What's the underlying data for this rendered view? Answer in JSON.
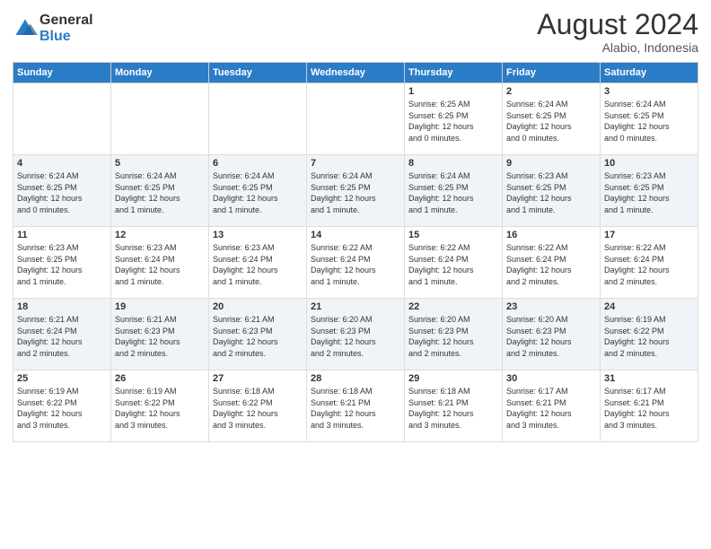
{
  "header": {
    "logo_general": "General",
    "logo_blue": "Blue",
    "main_title": "August 2024",
    "subtitle": "Alabio, Indonesia"
  },
  "days_of_week": [
    "Sunday",
    "Monday",
    "Tuesday",
    "Wednesday",
    "Thursday",
    "Friday",
    "Saturday"
  ],
  "weeks": [
    [
      {
        "num": "",
        "info": ""
      },
      {
        "num": "",
        "info": ""
      },
      {
        "num": "",
        "info": ""
      },
      {
        "num": "",
        "info": ""
      },
      {
        "num": "1",
        "info": "Sunrise: 6:25 AM\nSunset: 6:25 PM\nDaylight: 12 hours\nand 0 minutes."
      },
      {
        "num": "2",
        "info": "Sunrise: 6:24 AM\nSunset: 6:25 PM\nDaylight: 12 hours\nand 0 minutes."
      },
      {
        "num": "3",
        "info": "Sunrise: 6:24 AM\nSunset: 6:25 PM\nDaylight: 12 hours\nand 0 minutes."
      }
    ],
    [
      {
        "num": "4",
        "info": "Sunrise: 6:24 AM\nSunset: 6:25 PM\nDaylight: 12 hours\nand 0 minutes."
      },
      {
        "num": "5",
        "info": "Sunrise: 6:24 AM\nSunset: 6:25 PM\nDaylight: 12 hours\nand 1 minute."
      },
      {
        "num": "6",
        "info": "Sunrise: 6:24 AM\nSunset: 6:25 PM\nDaylight: 12 hours\nand 1 minute."
      },
      {
        "num": "7",
        "info": "Sunrise: 6:24 AM\nSunset: 6:25 PM\nDaylight: 12 hours\nand 1 minute."
      },
      {
        "num": "8",
        "info": "Sunrise: 6:24 AM\nSunset: 6:25 PM\nDaylight: 12 hours\nand 1 minute."
      },
      {
        "num": "9",
        "info": "Sunrise: 6:23 AM\nSunset: 6:25 PM\nDaylight: 12 hours\nand 1 minute."
      },
      {
        "num": "10",
        "info": "Sunrise: 6:23 AM\nSunset: 6:25 PM\nDaylight: 12 hours\nand 1 minute."
      }
    ],
    [
      {
        "num": "11",
        "info": "Sunrise: 6:23 AM\nSunset: 6:25 PM\nDaylight: 12 hours\nand 1 minute."
      },
      {
        "num": "12",
        "info": "Sunrise: 6:23 AM\nSunset: 6:24 PM\nDaylight: 12 hours\nand 1 minute."
      },
      {
        "num": "13",
        "info": "Sunrise: 6:23 AM\nSunset: 6:24 PM\nDaylight: 12 hours\nand 1 minute."
      },
      {
        "num": "14",
        "info": "Sunrise: 6:22 AM\nSunset: 6:24 PM\nDaylight: 12 hours\nand 1 minute."
      },
      {
        "num": "15",
        "info": "Sunrise: 6:22 AM\nSunset: 6:24 PM\nDaylight: 12 hours\nand 1 minute."
      },
      {
        "num": "16",
        "info": "Sunrise: 6:22 AM\nSunset: 6:24 PM\nDaylight: 12 hours\nand 2 minutes."
      },
      {
        "num": "17",
        "info": "Sunrise: 6:22 AM\nSunset: 6:24 PM\nDaylight: 12 hours\nand 2 minutes."
      }
    ],
    [
      {
        "num": "18",
        "info": "Sunrise: 6:21 AM\nSunset: 6:24 PM\nDaylight: 12 hours\nand 2 minutes."
      },
      {
        "num": "19",
        "info": "Sunrise: 6:21 AM\nSunset: 6:23 PM\nDaylight: 12 hours\nand 2 minutes."
      },
      {
        "num": "20",
        "info": "Sunrise: 6:21 AM\nSunset: 6:23 PM\nDaylight: 12 hours\nand 2 minutes."
      },
      {
        "num": "21",
        "info": "Sunrise: 6:20 AM\nSunset: 6:23 PM\nDaylight: 12 hours\nand 2 minutes."
      },
      {
        "num": "22",
        "info": "Sunrise: 6:20 AM\nSunset: 6:23 PM\nDaylight: 12 hours\nand 2 minutes."
      },
      {
        "num": "23",
        "info": "Sunrise: 6:20 AM\nSunset: 6:23 PM\nDaylight: 12 hours\nand 2 minutes."
      },
      {
        "num": "24",
        "info": "Sunrise: 6:19 AM\nSunset: 6:22 PM\nDaylight: 12 hours\nand 2 minutes."
      }
    ],
    [
      {
        "num": "25",
        "info": "Sunrise: 6:19 AM\nSunset: 6:22 PM\nDaylight: 12 hours\nand 3 minutes."
      },
      {
        "num": "26",
        "info": "Sunrise: 6:19 AM\nSunset: 6:22 PM\nDaylight: 12 hours\nand 3 minutes."
      },
      {
        "num": "27",
        "info": "Sunrise: 6:18 AM\nSunset: 6:22 PM\nDaylight: 12 hours\nand 3 minutes."
      },
      {
        "num": "28",
        "info": "Sunrise: 6:18 AM\nSunset: 6:21 PM\nDaylight: 12 hours\nand 3 minutes."
      },
      {
        "num": "29",
        "info": "Sunrise: 6:18 AM\nSunset: 6:21 PM\nDaylight: 12 hours\nand 3 minutes."
      },
      {
        "num": "30",
        "info": "Sunrise: 6:17 AM\nSunset: 6:21 PM\nDaylight: 12 hours\nand 3 minutes."
      },
      {
        "num": "31",
        "info": "Sunrise: 6:17 AM\nSunset: 6:21 PM\nDaylight: 12 hours\nand 3 minutes."
      }
    ]
  ]
}
